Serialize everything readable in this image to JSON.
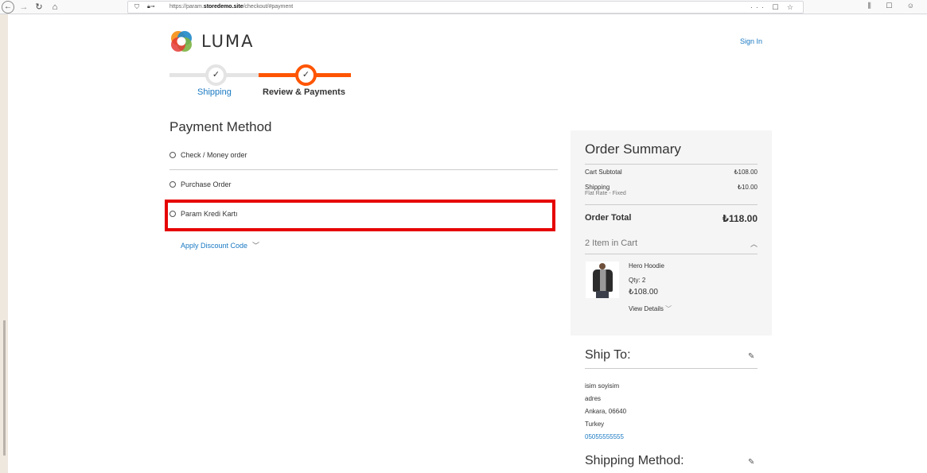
{
  "browser": {
    "url_prefix": "https://param.",
    "url_domain": "storedemo.site",
    "url_path": "/checkout/#payment",
    "page_actions": "··· ☐ ☆",
    "toolbar_right": "⫼ ☐ ☺"
  },
  "header": {
    "logo_text": "LUMA",
    "sign_in": "Sign In"
  },
  "progress": {
    "step1_label": "Shipping",
    "step2_label": "Review & Payments",
    "check": "✓"
  },
  "payment": {
    "title": "Payment Method",
    "options": [
      {
        "label": "Check / Money order"
      },
      {
        "label": "Purchase Order"
      },
      {
        "label": "Param Kredi Kartı"
      }
    ],
    "discount_label": "Apply Discount Code"
  },
  "summary": {
    "title": "Order Summary",
    "subtotal_label": "Cart Subtotal",
    "subtotal_value": "₺108.00",
    "shipping_label": "Shipping",
    "shipping_sub": "Flat Rate - Fixed",
    "shipping_value": "₺10.00",
    "total_label": "Order Total",
    "total_value": "₺118.00",
    "cart_count": "2 Item in Cart",
    "item": {
      "name": "Hero Hoodie",
      "qty": "Qty: 2",
      "price": "₺108.00",
      "details": "View Details"
    }
  },
  "ship_to": {
    "title": "Ship To:",
    "name": "isim soyisim",
    "address": "adres",
    "city": "Ankara, 06640",
    "country": "Turkey",
    "phone": "05055555555"
  },
  "shipping_method": {
    "title": "Shipping Method:"
  },
  "colors": {
    "accent_orange": "#ff5501",
    "link_blue": "#1979c3",
    "highlight_red": "#e60000"
  }
}
